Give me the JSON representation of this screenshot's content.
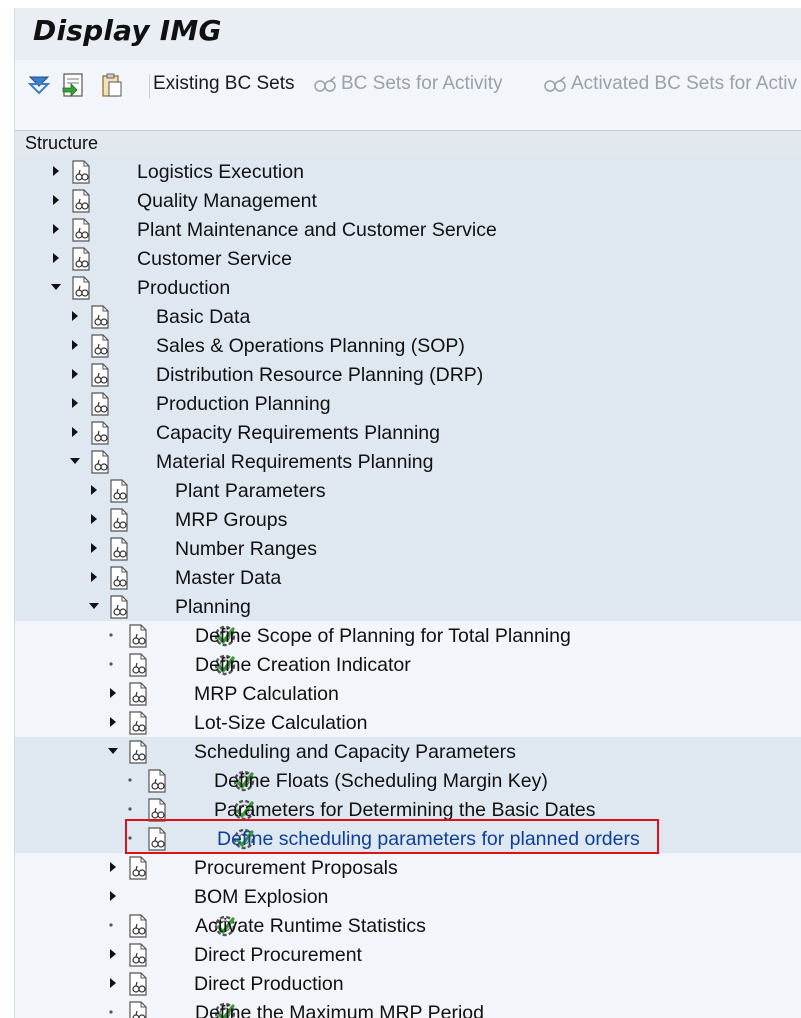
{
  "window": {
    "title": "Display IMG"
  },
  "toolbar": {
    "icons": [
      "expand-icon",
      "import-icon",
      "clipboard-icon"
    ],
    "existing_bc_sets": "Existing BC Sets",
    "bc_sets_for_activity": "BC Sets for Activity",
    "activated_bc_sets": "Activated BC Sets for Activ"
  },
  "structure": {
    "header": "Structure"
  },
  "tree": [
    {
      "level": 0,
      "toggle": "collapsed",
      "doc": true,
      "activity": false,
      "label": "Logistics Execution"
    },
    {
      "level": 0,
      "toggle": "collapsed",
      "doc": true,
      "activity": false,
      "label": "Quality Management"
    },
    {
      "level": 0,
      "toggle": "collapsed",
      "doc": true,
      "activity": false,
      "label": "Plant Maintenance and Customer Service"
    },
    {
      "level": 0,
      "toggle": "collapsed",
      "doc": true,
      "activity": false,
      "label": "Customer Service"
    },
    {
      "level": 0,
      "toggle": "expanded",
      "doc": true,
      "activity": false,
      "label": "Production"
    },
    {
      "level": 1,
      "toggle": "collapsed",
      "doc": true,
      "activity": false,
      "label": "Basic Data"
    },
    {
      "level": 1,
      "toggle": "collapsed",
      "doc": true,
      "activity": false,
      "label": "Sales & Operations Planning (SOP)"
    },
    {
      "level": 1,
      "toggle": "collapsed",
      "doc": true,
      "activity": false,
      "label": "Distribution Resource Planning (DRP)"
    },
    {
      "level": 1,
      "toggle": "collapsed",
      "doc": true,
      "activity": false,
      "label": "Production Planning"
    },
    {
      "level": 1,
      "toggle": "collapsed",
      "doc": true,
      "activity": false,
      "label": "Capacity Requirements Planning"
    },
    {
      "level": 1,
      "toggle": "expanded",
      "doc": true,
      "activity": false,
      "label": "Material Requirements Planning"
    },
    {
      "level": 2,
      "toggle": "collapsed",
      "doc": true,
      "activity": false,
      "label": "Plant Parameters"
    },
    {
      "level": 2,
      "toggle": "collapsed",
      "doc": true,
      "activity": false,
      "label": "MRP Groups"
    },
    {
      "level": 2,
      "toggle": "collapsed",
      "doc": true,
      "activity": false,
      "label": "Number Ranges"
    },
    {
      "level": 2,
      "toggle": "collapsed",
      "doc": true,
      "activity": false,
      "label": "Master Data"
    },
    {
      "level": 2,
      "toggle": "expanded",
      "doc": true,
      "activity": false,
      "label": "Planning"
    },
    {
      "level": 3,
      "toggle": "leaf",
      "doc": true,
      "activity": true,
      "label": "Define Scope of Planning for Total Planning"
    },
    {
      "level": 3,
      "toggle": "leaf",
      "doc": true,
      "activity": true,
      "label": "Define Creation Indicator"
    },
    {
      "level": 3,
      "toggle": "collapsed",
      "doc": true,
      "activity": false,
      "label": "MRP Calculation"
    },
    {
      "level": 3,
      "toggle": "collapsed",
      "doc": true,
      "activity": false,
      "label": "Lot-Size Calculation"
    },
    {
      "level": 3,
      "toggle": "expanded",
      "doc": true,
      "activity": false,
      "label": "Scheduling and Capacity Parameters"
    },
    {
      "level": 4,
      "toggle": "leaf",
      "doc": true,
      "activity": true,
      "label": "Define Floats (Scheduling Margin Key)"
    },
    {
      "level": 4,
      "toggle": "leaf",
      "doc": true,
      "activity": true,
      "label": "Parameters for Determining the Basic Dates"
    },
    {
      "level": 4,
      "toggle": "leaf",
      "doc": true,
      "activity": true,
      "label": "Define scheduling parameters for planned orders",
      "selected": true
    },
    {
      "level": 3,
      "toggle": "collapsed",
      "doc": true,
      "activity": false,
      "label": "Procurement Proposals"
    },
    {
      "level": 3,
      "toggle": "collapsed",
      "doc": false,
      "activity": false,
      "label": "BOM Explosion"
    },
    {
      "level": 3,
      "toggle": "leaf",
      "doc": true,
      "activity": true,
      "label": "Activate Runtime Statistics"
    },
    {
      "level": 3,
      "toggle": "collapsed",
      "doc": true,
      "activity": false,
      "label": "Direct Procurement"
    },
    {
      "level": 3,
      "toggle": "collapsed",
      "doc": true,
      "activity": false,
      "label": "Direct Production"
    },
    {
      "level": 3,
      "toggle": "leaf",
      "doc": true,
      "activity": true,
      "label": "Define the Maximum MRP Period"
    }
  ],
  "colors": {
    "link": "#0b3f9a",
    "highlight_border": "#e0101a",
    "shaded_row": "#dfe8f1",
    "activity_icon": "#3a9a3a"
  }
}
